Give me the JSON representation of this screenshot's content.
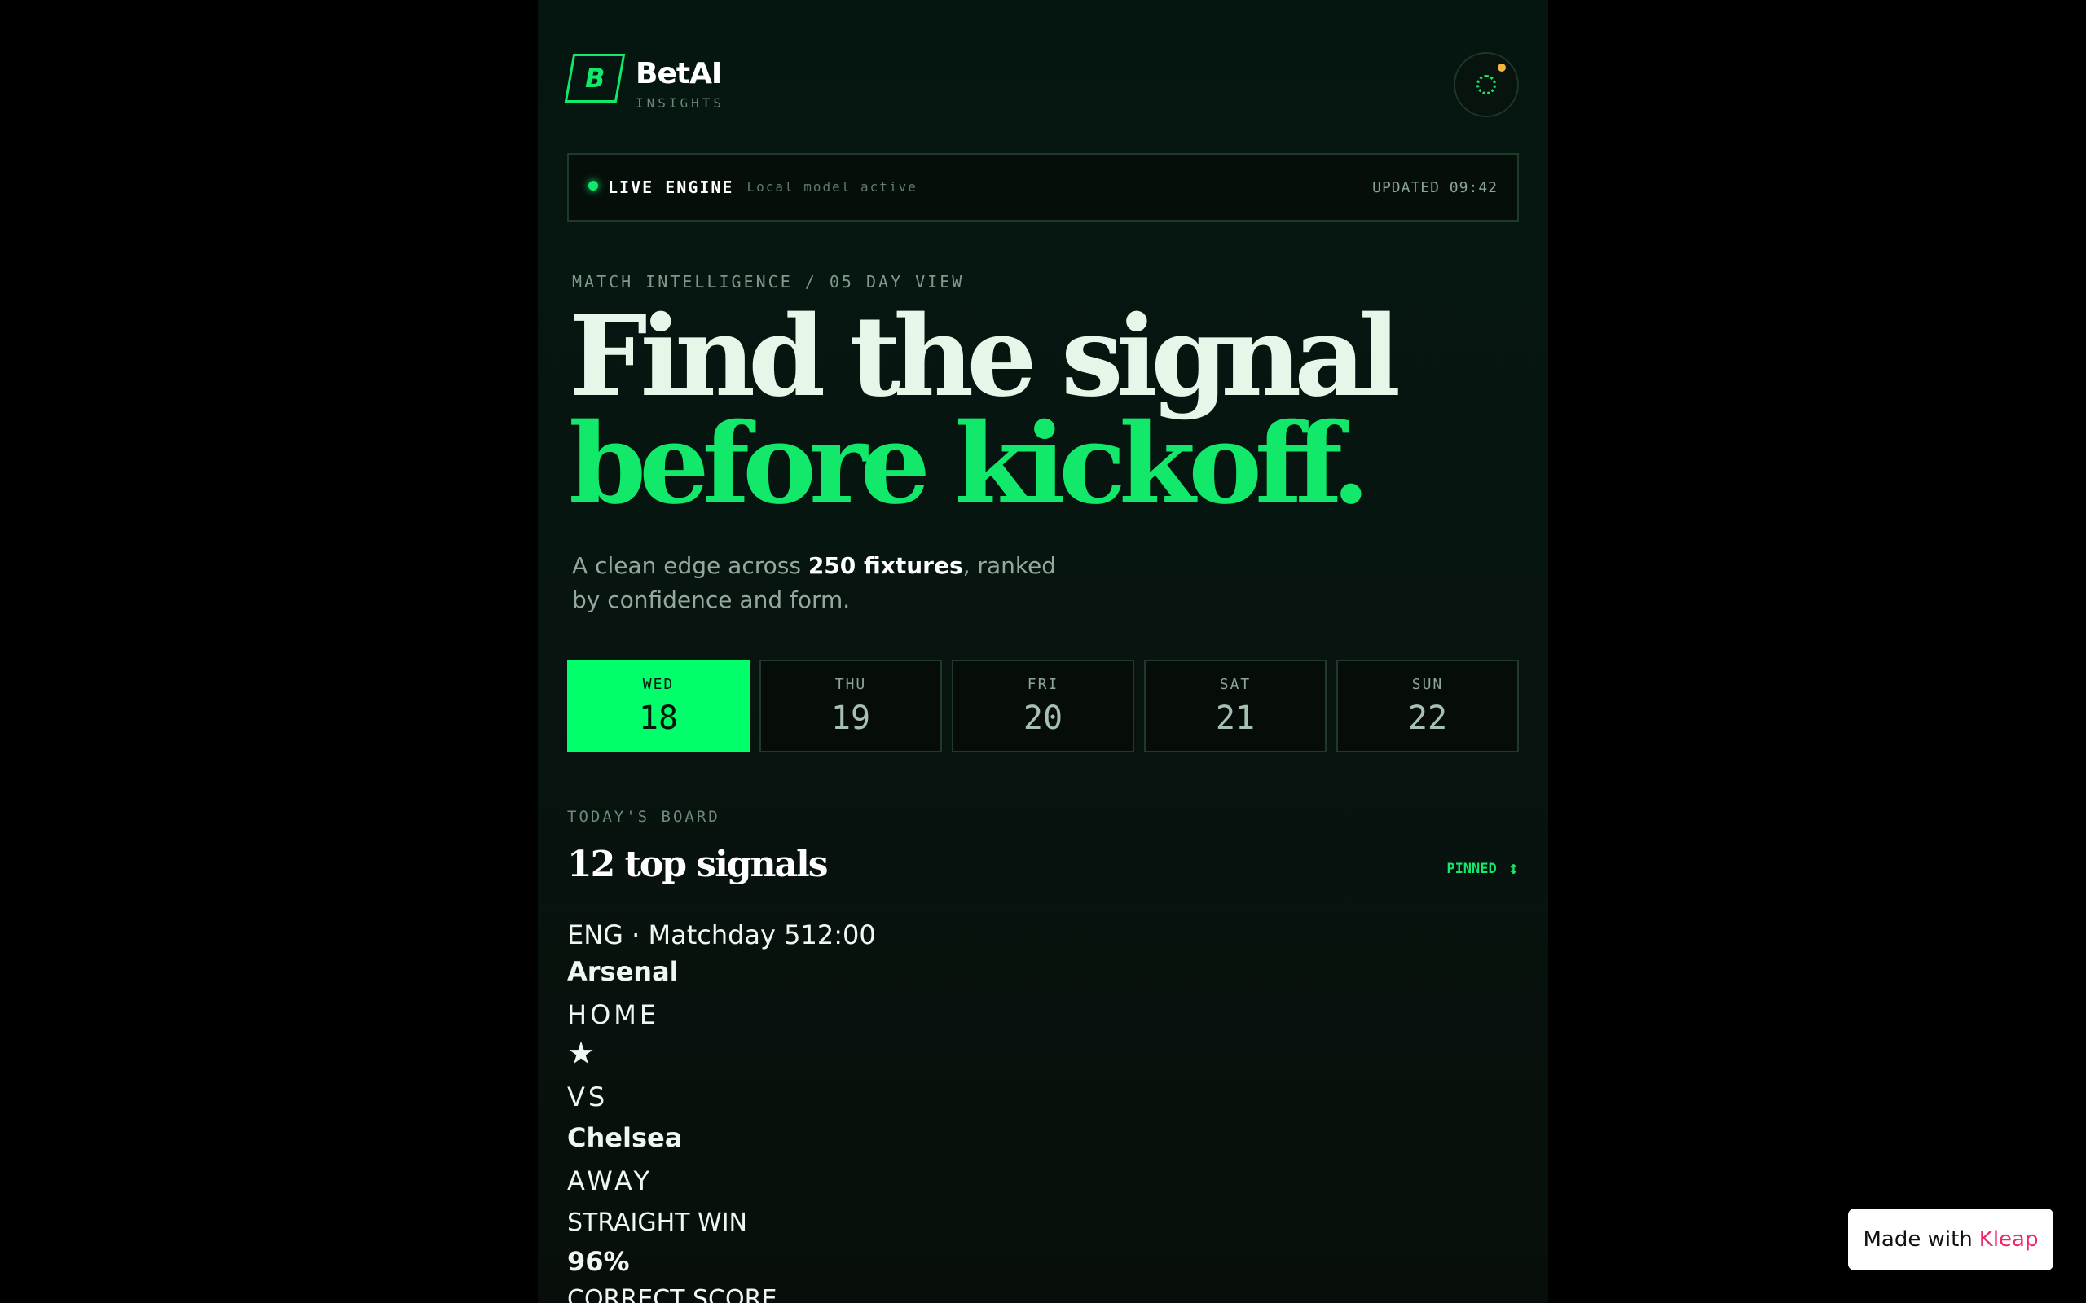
{
  "brand": {
    "logo_letter": "B",
    "name": "BetAI",
    "subtitle": "INSIGHTS"
  },
  "status_indicator": {
    "icon": "loading-ring-icon",
    "dot_color": "#f4b53a"
  },
  "engine": {
    "title": "LIVE ENGINE",
    "subtitle": "Local model active",
    "updated": "UPDATED 09:42"
  },
  "hero": {
    "kicker": "MATCH INTELLIGENCE / 05 DAY VIEW",
    "headline_line1": "Find the signal",
    "headline_line2": "before kickoff.",
    "lede_prefix": "A clean edge across ",
    "lede_bold": "250 fixtures",
    "lede_suffix": ", ranked by confidence and form."
  },
  "days": [
    {
      "name": "WED",
      "num": "18",
      "active": true
    },
    {
      "name": "THU",
      "num": "19",
      "active": false
    },
    {
      "name": "FRI",
      "num": "20",
      "active": false
    },
    {
      "name": "SAT",
      "num": "21",
      "active": false
    },
    {
      "name": "SUN",
      "num": "22",
      "active": false
    }
  ],
  "board": {
    "label": "TODAY'S BOARD",
    "title": "12 top signals",
    "sort_label": "PINNED",
    "sort_icon": "sort-arrows-icon"
  },
  "match": {
    "meta": "ENG · Matchday 512:00",
    "home_team": "Arsenal",
    "home_label": "HOME",
    "star": "★",
    "vs": "VS",
    "away_team": "Chelsea",
    "away_label": "AWAY",
    "pick": "STRAIGHT WIN",
    "confidence": "96%",
    "pick2": "CORRECT SCORE"
  },
  "badge": {
    "prefix": "Made with",
    "brand": "Kleap"
  },
  "colors": {
    "accent": "#12e86a",
    "background": "#000000",
    "panel": "#061510"
  }
}
